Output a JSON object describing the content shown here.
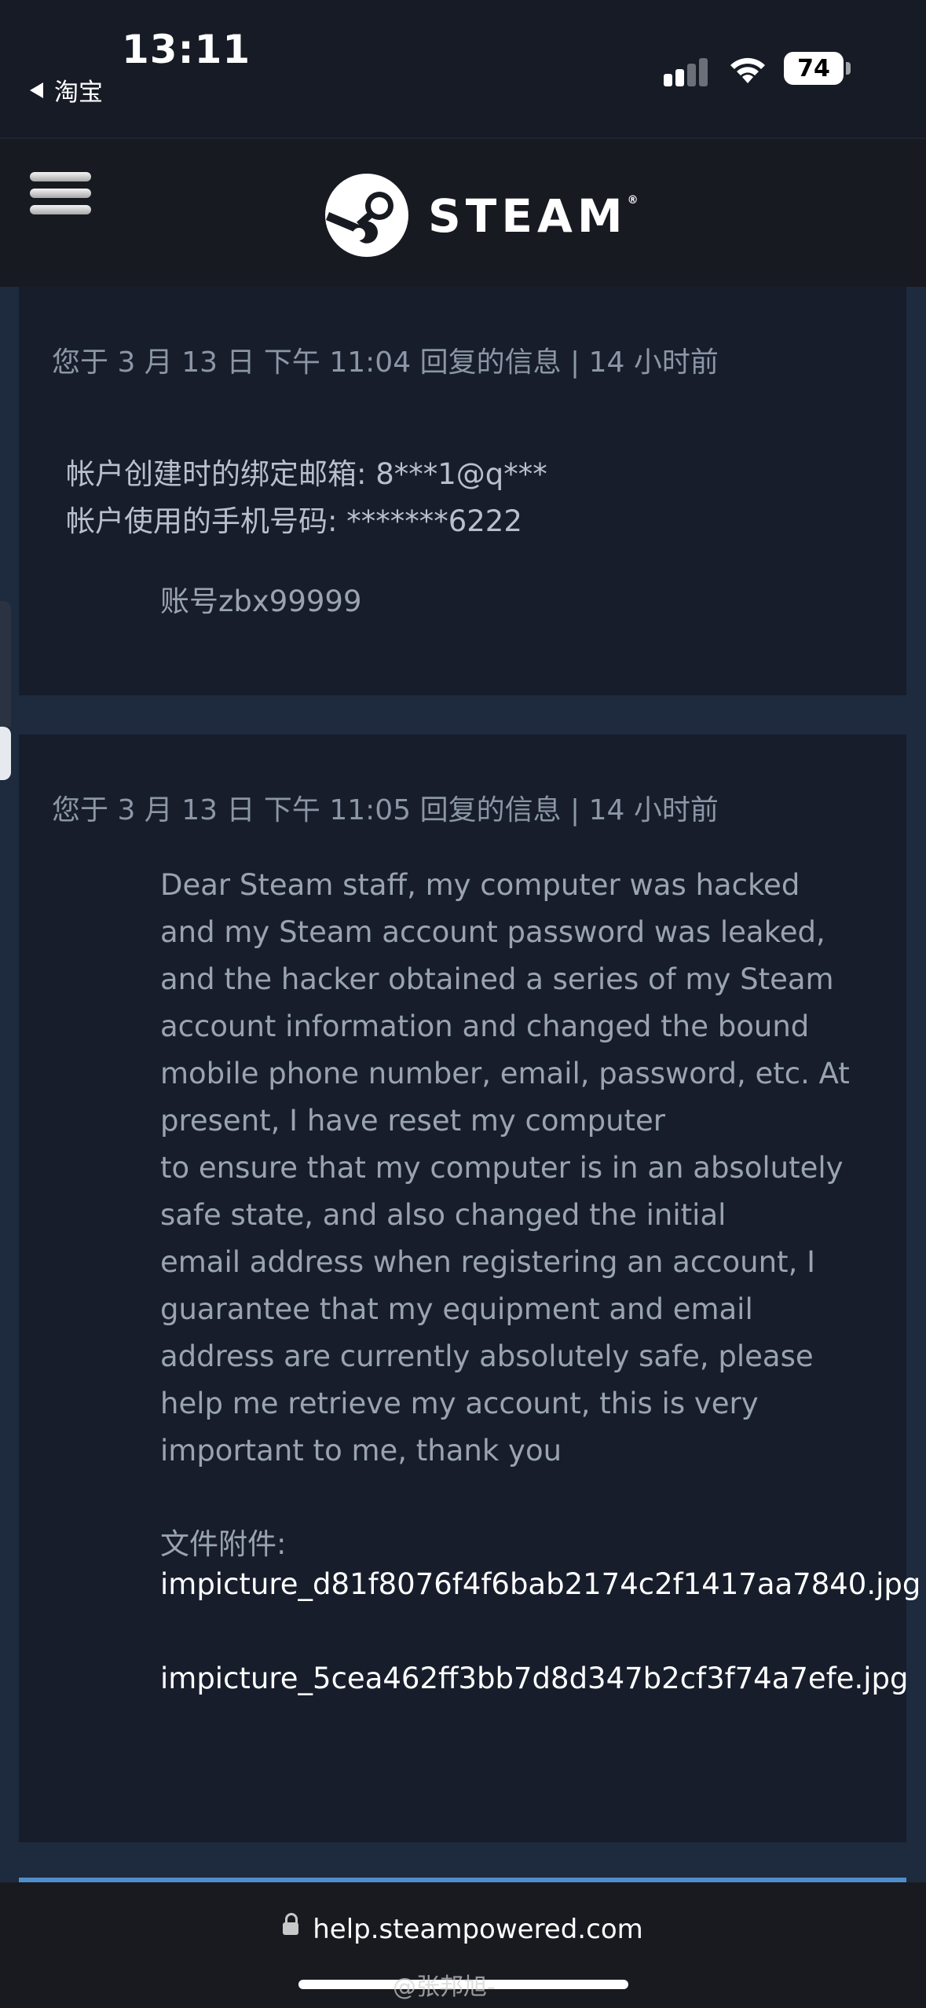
{
  "status_bar": {
    "time": "13:11",
    "back_app": "淘宝",
    "battery": "74",
    "icons": [
      "signal-icon",
      "wifi-icon",
      "battery-icon"
    ]
  },
  "nav": {
    "brand": "STEAM",
    "brand_mark": "®",
    "icons": [
      "menu-icon",
      "steam-logo-icon"
    ]
  },
  "messages": [
    {
      "meta": "您于 3 月 13 日 下午 11:04 回复的信息 | 14 小时前",
      "lines": [
        "帐户创建时的绑定邮箱: 8***1@q***",
        "帐户使用的手机号码: *******6222"
      ],
      "account": "账号zbx99999"
    },
    {
      "meta": "您于 3 月 13 日 下午 11:05 回复的信息 | 14 小时前",
      "body_lines": [
        "Dear Steam staff, my computer was hacked",
        "and my Steam account password was leaked,",
        "and the hacker obtained a series of my Steam",
        "account information and changed the bound",
        "mobile phone number, email, password, etc. At",
        "present, I have reset my computer",
        "to ensure that my computer is in an absolutely",
        "safe state, and also changed the initial",
        "email address when registering an account, I",
        "guarantee that my equipment and email",
        "address are currently absolutely safe, please",
        "help me retrieve my account, this is very",
        "important to me, thank you"
      ],
      "attachments_label": "文件附件:",
      "attachments": [
        "impicture_d81f8076f4f6bab2174c2f1417aa7840.jpg",
        "impicture_5cea462ff3bb7d8d347b2cf3f74a7efe.jpg"
      ]
    }
  ],
  "browser": {
    "url": "help.steampowered.com",
    "icons": [
      "lock-icon"
    ]
  },
  "watermark": "@张邦旭-"
}
